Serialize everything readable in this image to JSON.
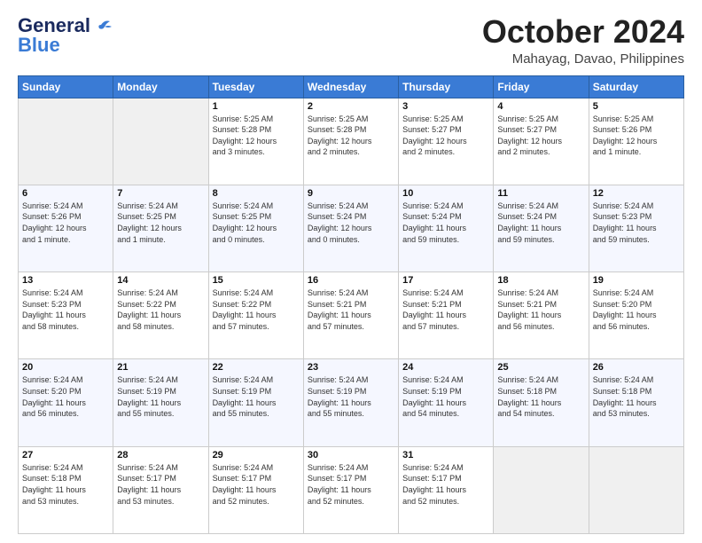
{
  "header": {
    "logo_line1": "General",
    "logo_line2": "Blue",
    "month": "October 2024",
    "location": "Mahayag, Davao, Philippines"
  },
  "weekdays": [
    "Sunday",
    "Monday",
    "Tuesday",
    "Wednesday",
    "Thursday",
    "Friday",
    "Saturday"
  ],
  "weeks": [
    [
      {
        "day": "",
        "detail": ""
      },
      {
        "day": "",
        "detail": ""
      },
      {
        "day": "1",
        "detail": "Sunrise: 5:25 AM\nSunset: 5:28 PM\nDaylight: 12 hours\nand 3 minutes."
      },
      {
        "day": "2",
        "detail": "Sunrise: 5:25 AM\nSunset: 5:28 PM\nDaylight: 12 hours\nand 2 minutes."
      },
      {
        "day": "3",
        "detail": "Sunrise: 5:25 AM\nSunset: 5:27 PM\nDaylight: 12 hours\nand 2 minutes."
      },
      {
        "day": "4",
        "detail": "Sunrise: 5:25 AM\nSunset: 5:27 PM\nDaylight: 12 hours\nand 2 minutes."
      },
      {
        "day": "5",
        "detail": "Sunrise: 5:25 AM\nSunset: 5:26 PM\nDaylight: 12 hours\nand 1 minute."
      }
    ],
    [
      {
        "day": "6",
        "detail": "Sunrise: 5:24 AM\nSunset: 5:26 PM\nDaylight: 12 hours\nand 1 minute."
      },
      {
        "day": "7",
        "detail": "Sunrise: 5:24 AM\nSunset: 5:25 PM\nDaylight: 12 hours\nand 1 minute."
      },
      {
        "day": "8",
        "detail": "Sunrise: 5:24 AM\nSunset: 5:25 PM\nDaylight: 12 hours\nand 0 minutes."
      },
      {
        "day": "9",
        "detail": "Sunrise: 5:24 AM\nSunset: 5:24 PM\nDaylight: 12 hours\nand 0 minutes."
      },
      {
        "day": "10",
        "detail": "Sunrise: 5:24 AM\nSunset: 5:24 PM\nDaylight: 11 hours\nand 59 minutes."
      },
      {
        "day": "11",
        "detail": "Sunrise: 5:24 AM\nSunset: 5:24 PM\nDaylight: 11 hours\nand 59 minutes."
      },
      {
        "day": "12",
        "detail": "Sunrise: 5:24 AM\nSunset: 5:23 PM\nDaylight: 11 hours\nand 59 minutes."
      }
    ],
    [
      {
        "day": "13",
        "detail": "Sunrise: 5:24 AM\nSunset: 5:23 PM\nDaylight: 11 hours\nand 58 minutes."
      },
      {
        "day": "14",
        "detail": "Sunrise: 5:24 AM\nSunset: 5:22 PM\nDaylight: 11 hours\nand 58 minutes."
      },
      {
        "day": "15",
        "detail": "Sunrise: 5:24 AM\nSunset: 5:22 PM\nDaylight: 11 hours\nand 57 minutes."
      },
      {
        "day": "16",
        "detail": "Sunrise: 5:24 AM\nSunset: 5:21 PM\nDaylight: 11 hours\nand 57 minutes."
      },
      {
        "day": "17",
        "detail": "Sunrise: 5:24 AM\nSunset: 5:21 PM\nDaylight: 11 hours\nand 57 minutes."
      },
      {
        "day": "18",
        "detail": "Sunrise: 5:24 AM\nSunset: 5:21 PM\nDaylight: 11 hours\nand 56 minutes."
      },
      {
        "day": "19",
        "detail": "Sunrise: 5:24 AM\nSunset: 5:20 PM\nDaylight: 11 hours\nand 56 minutes."
      }
    ],
    [
      {
        "day": "20",
        "detail": "Sunrise: 5:24 AM\nSunset: 5:20 PM\nDaylight: 11 hours\nand 56 minutes."
      },
      {
        "day": "21",
        "detail": "Sunrise: 5:24 AM\nSunset: 5:19 PM\nDaylight: 11 hours\nand 55 minutes."
      },
      {
        "day": "22",
        "detail": "Sunrise: 5:24 AM\nSunset: 5:19 PM\nDaylight: 11 hours\nand 55 minutes."
      },
      {
        "day": "23",
        "detail": "Sunrise: 5:24 AM\nSunset: 5:19 PM\nDaylight: 11 hours\nand 55 minutes."
      },
      {
        "day": "24",
        "detail": "Sunrise: 5:24 AM\nSunset: 5:19 PM\nDaylight: 11 hours\nand 54 minutes."
      },
      {
        "day": "25",
        "detail": "Sunrise: 5:24 AM\nSunset: 5:18 PM\nDaylight: 11 hours\nand 54 minutes."
      },
      {
        "day": "26",
        "detail": "Sunrise: 5:24 AM\nSunset: 5:18 PM\nDaylight: 11 hours\nand 53 minutes."
      }
    ],
    [
      {
        "day": "27",
        "detail": "Sunrise: 5:24 AM\nSunset: 5:18 PM\nDaylight: 11 hours\nand 53 minutes."
      },
      {
        "day": "28",
        "detail": "Sunrise: 5:24 AM\nSunset: 5:17 PM\nDaylight: 11 hours\nand 53 minutes."
      },
      {
        "day": "29",
        "detail": "Sunrise: 5:24 AM\nSunset: 5:17 PM\nDaylight: 11 hours\nand 52 minutes."
      },
      {
        "day": "30",
        "detail": "Sunrise: 5:24 AM\nSunset: 5:17 PM\nDaylight: 11 hours\nand 52 minutes."
      },
      {
        "day": "31",
        "detail": "Sunrise: 5:24 AM\nSunset: 5:17 PM\nDaylight: 11 hours\nand 52 minutes."
      },
      {
        "day": "",
        "detail": ""
      },
      {
        "day": "",
        "detail": ""
      }
    ]
  ]
}
